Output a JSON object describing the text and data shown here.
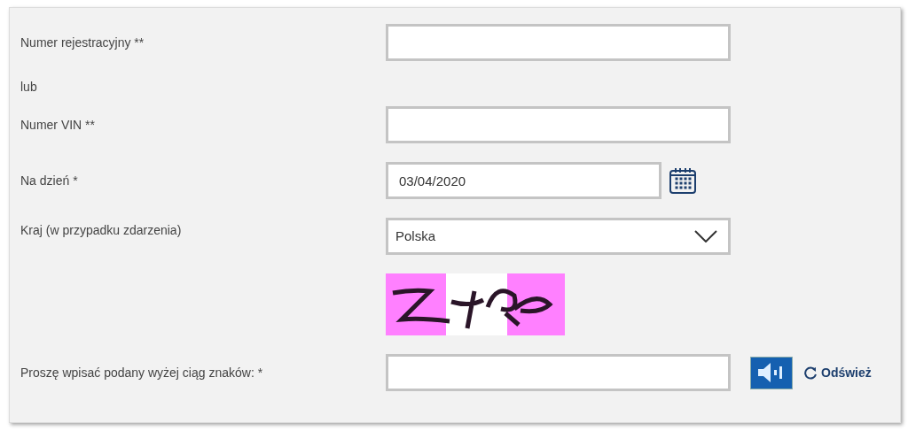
{
  "rows": [
    {
      "kind": "text",
      "label": "Numer rejestracyjny **",
      "value": ""
    },
    {
      "kind": "note",
      "label": "lub"
    },
    {
      "kind": "text",
      "label": "Numer VIN **",
      "value": ""
    },
    {
      "kind": "date",
      "label": "Na dzień  *",
      "value": "03/04/2020"
    },
    {
      "kind": "select",
      "label": "Kraj (w przypadku zdarzenia)",
      "value": "Polska"
    },
    {
      "kind": "captcha"
    },
    {
      "kind": "captcha_input",
      "label": "Proszę wpisać podany wyżej ciąg znaków:  *",
      "value": "",
      "refresh": "Odśwież"
    }
  ]
}
